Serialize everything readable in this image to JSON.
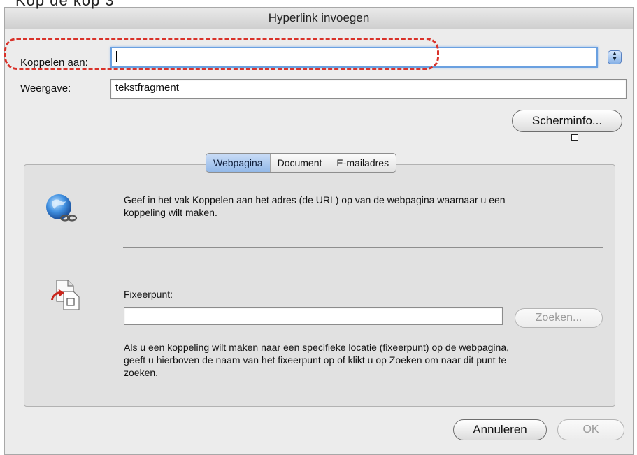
{
  "dialog": {
    "title": "Hyperlink invoegen"
  },
  "top_fragment": "Kop de kop 3",
  "form": {
    "link_label": "Koppelen aan:",
    "link_value": "",
    "display_label": "Weergave:",
    "display_value": "tekstfragment",
    "screeninfo_button": "Scherminfo..."
  },
  "tabs": [
    {
      "label": "Webpagina",
      "active": true
    },
    {
      "label": "Document",
      "active": false
    },
    {
      "label": "E-mailadres",
      "active": false
    }
  ],
  "panel": {
    "instruction": "Geef in het vak Koppelen aan het adres (de URL) op van de webpagina waarnaar u een koppeling wilt maken.",
    "anchor_label": "Fixeerpunt:",
    "anchor_value": "",
    "search_button": "Zoeken...",
    "anchor_help": "Als u een koppeling wilt maken naar een specifieke locatie (fixeerpunt) op de webpagina, geeft u hierboven de naam van het fixeerpunt op of klikt u op Zoeken om naar dit punt te zoeken."
  },
  "footer": {
    "cancel_button": "Annuleren",
    "ok_button": "OK"
  },
  "colors": {
    "highlight": "#d9322a",
    "tab_active": "#92b8e8",
    "dialog_bg": "#ececec"
  },
  "icons": {
    "globe": "globe-link-icon",
    "anchor": "anchor-document-icon",
    "stepper": "stepper-icon"
  }
}
